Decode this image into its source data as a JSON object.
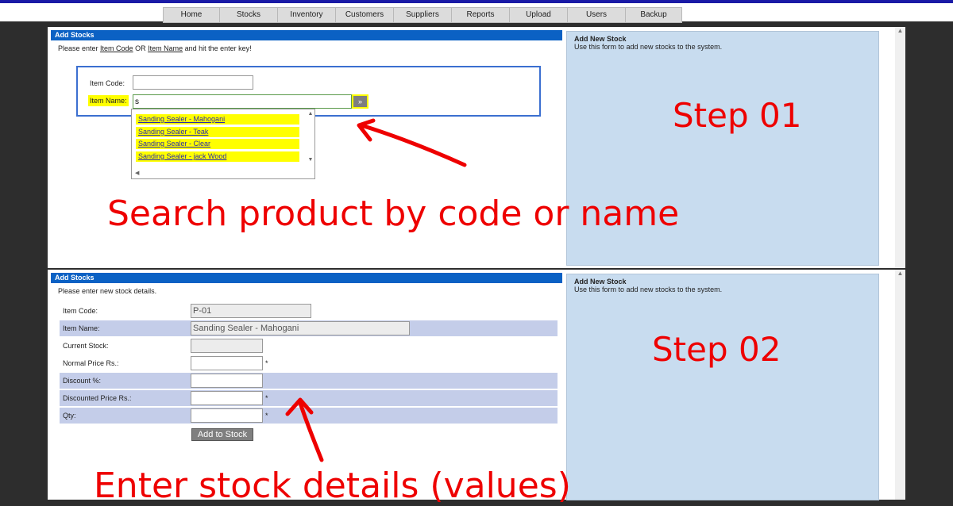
{
  "nav": {
    "items": [
      {
        "label": "Home"
      },
      {
        "label": "Stocks"
      },
      {
        "label": "Inventory"
      },
      {
        "label": "Customers"
      },
      {
        "label": "Suppliers"
      },
      {
        "label": "Reports"
      },
      {
        "label": "Upload"
      },
      {
        "label": "Users"
      },
      {
        "label": "Backup"
      }
    ]
  },
  "step1": {
    "header": "Add Stocks",
    "intro": {
      "pre": "Please enter ",
      "code_link": "Item Code",
      "or": " OR ",
      "name_link": "Item Name",
      "post": " and hit the enter key!"
    },
    "item_code_label": "Item Code:",
    "item_code_value": "",
    "item_name_label": "Item Name:",
    "item_name_value": "s",
    "go_button": "»",
    "suggestions": [
      "Sanding Sealer - Mahogani",
      "Sanding Sealer - Teak",
      "Sanding Sealer - Clear",
      "Sanding Sealer - jack Wood"
    ],
    "side_title": "Add New Stock",
    "side_desc": "Use this form to add new stocks to the system.",
    "step_label": "Step 01",
    "annotation": "Search product by code or name"
  },
  "step2": {
    "header": "Add Stocks",
    "intro": "Please enter new stock details.",
    "fields": [
      {
        "label": "Item Code:",
        "value": "P-01"
      },
      {
        "label": "Item Name:",
        "value": "Sanding Sealer - Mahogani"
      },
      {
        "label": "Current Stock:",
        "value": ""
      },
      {
        "label": "Normal Price Rs.:",
        "value": "",
        "required": "*"
      },
      {
        "label": "Discount %:",
        "value": ""
      },
      {
        "label": "Discounted Price Rs.:",
        "value": "",
        "required": "*"
      },
      {
        "label": "Qty:",
        "value": "",
        "required": "*"
      }
    ],
    "submit": "Add to Stock",
    "side_title": "Add New Stock",
    "side_desc": "Use this form to add new stocks to the system.",
    "step_label": "Step 02",
    "annotation": "Enter stock details (values)"
  },
  "colors": {
    "header_blue": "#0b61c4",
    "annotation_red": "#ee0000",
    "highlight_yellow": "#ffff00",
    "side_panel": "#c8dcef",
    "row_shade": "#c4cde9"
  },
  "icons": {
    "go": "arrow-right-icon",
    "arrow_annotation": "red-arrow-icon"
  }
}
